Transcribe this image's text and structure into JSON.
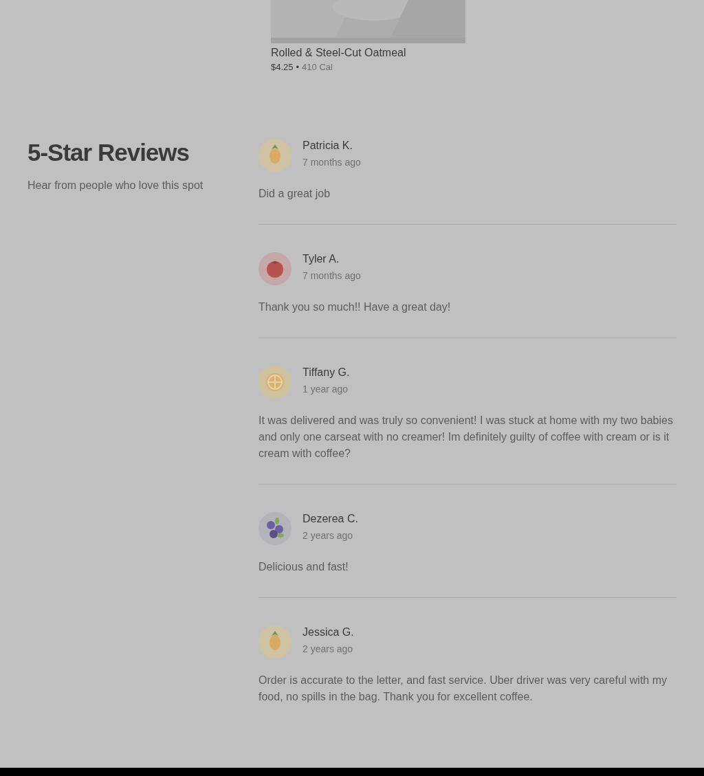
{
  "menu_item": {
    "kind": "picture",
    "name": "Rolled & Steel-Cut Oatmeal",
    "price": "$4.25",
    "separator": "•",
    "calories": "410 Cal"
  },
  "reviews_section": {
    "title": "5-Star Reviews",
    "subtitle": "Hear from people who love this spot",
    "reviews": [
      {
        "kind": "pineapple",
        "name": "Patricia K.",
        "time": "7 months ago",
        "text": "Did a great job"
      },
      {
        "kind": "tomato",
        "name": "Tyler A.",
        "time": "7 months ago",
        "text": "Thank you so much!! Have a great day!"
      },
      {
        "kind": "citrus",
        "name": "Tiffany G.",
        "time": "1 year ago",
        "text": "It was delivered and was truly so convenient! I was stuck at home with my two babies and only one carseat with no creamer! Im definitely guilty of coffee with cream or is it cream with coffee?"
      },
      {
        "kind": "blueberry",
        "name": "Dezerea C.",
        "time": "2 years ago",
        "text": "Delicious and fast!"
      },
      {
        "kind": "pineapple",
        "name": "Jessica G.",
        "time": "2 years ago",
        "text": "Order is accurate to the letter, and fast service. Uber driver was very careful with my food, no spills in the bag. Thank you for excellent coffee."
      }
    ]
  }
}
